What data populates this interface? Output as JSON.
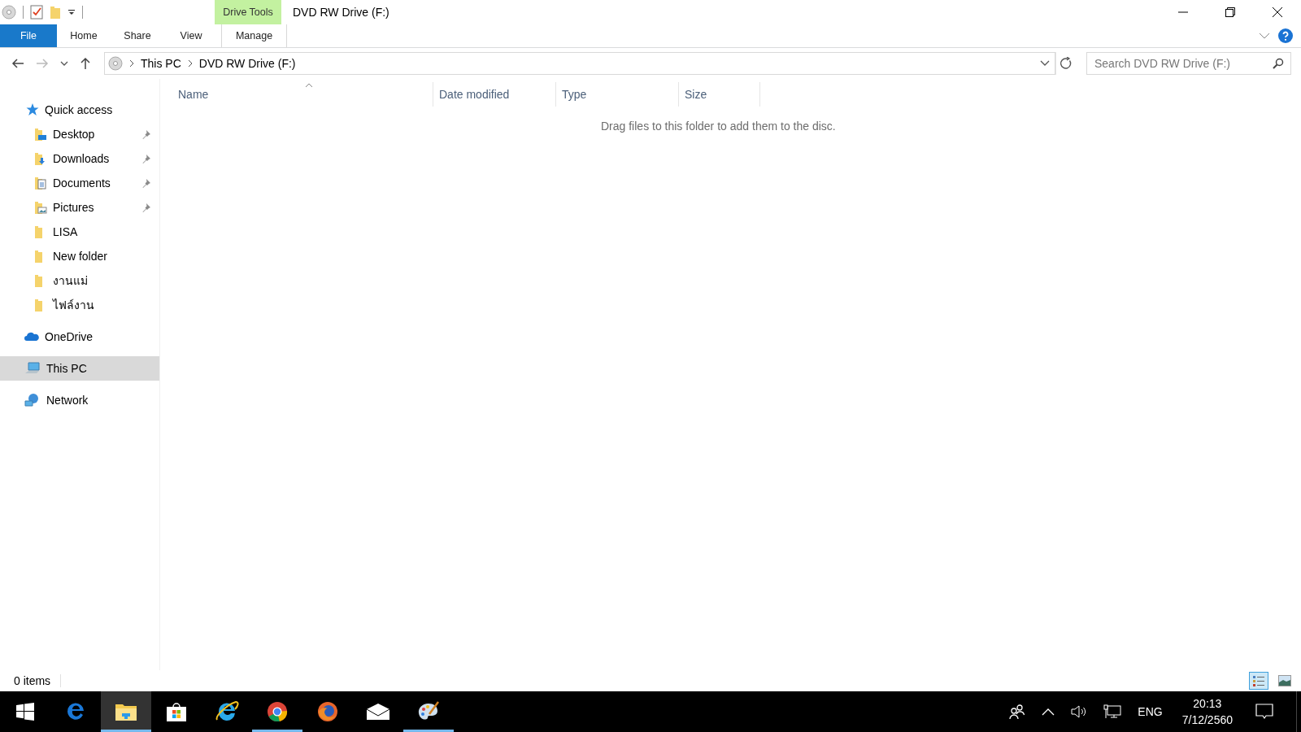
{
  "window": {
    "title": "DVD RW Drive (F:)",
    "context_tab_group": "Drive Tools"
  },
  "ribbon_tabs": [
    {
      "label": "File",
      "kind": "file",
      "selected": false
    },
    {
      "label": "Home",
      "kind": "normal",
      "selected": false
    },
    {
      "label": "Share",
      "kind": "normal",
      "selected": false
    },
    {
      "label": "View",
      "kind": "normal",
      "selected": false
    },
    {
      "label": "Manage",
      "kind": "contextual",
      "selected": false
    }
  ],
  "address_bar": {
    "crumbs": [
      "This PC",
      "DVD RW Drive (F:)"
    ]
  },
  "search": {
    "placeholder": "Search DVD RW Drive (F:)"
  },
  "sidebar": {
    "items": [
      {
        "label": "Quick access",
        "kind": "star",
        "selected": false,
        "children": [
          {
            "label": "Desktop",
            "kind": "desktop",
            "pinned": true,
            "selected": false
          },
          {
            "label": "Downloads",
            "kind": "downloads",
            "pinned": true,
            "selected": false
          },
          {
            "label": "Documents",
            "kind": "documents",
            "pinned": true,
            "selected": false
          },
          {
            "label": "Pictures",
            "kind": "pictures",
            "pinned": true,
            "selected": false
          },
          {
            "label": "LISA",
            "kind": "folder",
            "pinned": false,
            "selected": false
          },
          {
            "label": "New folder",
            "kind": "folder",
            "pinned": false,
            "selected": false
          },
          {
            "label": "งานแม่",
            "kind": "folder",
            "pinned": false,
            "selected": false
          },
          {
            "label": "ไฟล์งาน",
            "kind": "folder",
            "pinned": false,
            "selected": false
          }
        ]
      },
      {
        "label": "OneDrive",
        "kind": "cloud",
        "selected": false
      },
      {
        "label": "This PC",
        "kind": "pc",
        "selected": true
      },
      {
        "label": "Network",
        "kind": "network",
        "selected": false
      }
    ]
  },
  "file_list": {
    "columns": [
      {
        "label": "Name",
        "sorted": true
      },
      {
        "label": "Date modified",
        "sorted": false
      },
      {
        "label": "Type",
        "sorted": false
      },
      {
        "label": "Size",
        "sorted": false
      }
    ],
    "empty_message": "Drag files to this folder to add them to the disc."
  },
  "status_bar": {
    "count": "0 items",
    "views": [
      {
        "kind": "details",
        "selected": true
      },
      {
        "kind": "thumbnails",
        "selected": false
      }
    ]
  },
  "taskbar": {
    "apps": [
      {
        "kind": "edge",
        "active": false,
        "running": false
      },
      {
        "kind": "explorer",
        "active": true,
        "running": true
      },
      {
        "kind": "store",
        "active": false,
        "running": false
      },
      {
        "kind": "ie",
        "active": false,
        "running": false
      },
      {
        "kind": "chrome",
        "active": false,
        "running": true
      },
      {
        "kind": "firefox",
        "active": false,
        "running": false
      },
      {
        "kind": "mail",
        "active": false,
        "running": false
      },
      {
        "kind": "paint",
        "active": false,
        "running": true
      }
    ],
    "language": "ENG",
    "time": "20:13",
    "date": "7/12/2560"
  }
}
